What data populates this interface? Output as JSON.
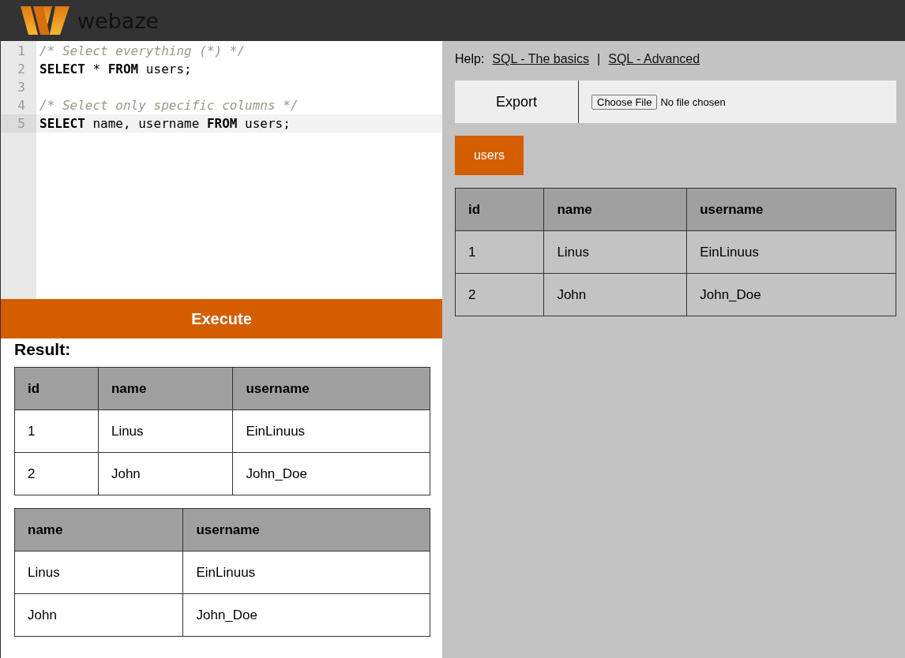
{
  "header": {
    "brand": "webaze"
  },
  "editor": {
    "lines": [
      {
        "number": "1",
        "selected": false,
        "tokens": [
          {
            "kind": "comment",
            "text": "/* Select everything (*) */"
          }
        ]
      },
      {
        "number": "2",
        "selected": false,
        "tokens": [
          {
            "kind": "keyword",
            "text": "SELECT"
          },
          {
            "kind": "plain",
            "text": " * "
          },
          {
            "kind": "keyword",
            "text": "FROM"
          },
          {
            "kind": "plain",
            "text": " users;"
          }
        ]
      },
      {
        "number": "3",
        "selected": false
      },
      {
        "number": "4",
        "selected": false,
        "tokens": [
          {
            "kind": "comment",
            "text": "/* Select only specific columns */"
          }
        ]
      },
      {
        "number": "5",
        "selected": true,
        "tokens": [
          {
            "kind": "keyword",
            "text": "SELECT"
          },
          {
            "kind": "plain",
            "text": " name, username "
          },
          {
            "kind": "keyword",
            "text": "FROM"
          },
          {
            "kind": "plain",
            "text": " users;"
          }
        ]
      }
    ]
  },
  "execute_button": "Execute",
  "result": {
    "heading": "Result:",
    "tables": [
      {
        "columns": [
          "id",
          "name",
          "username"
        ],
        "rows": [
          [
            "1",
            "Linus",
            "EinLinuus"
          ],
          [
            "2",
            "John",
            "John_Doe"
          ]
        ]
      },
      {
        "columns": [
          "name",
          "username"
        ],
        "rows": [
          [
            "Linus",
            "EinLinuus"
          ],
          [
            "John",
            "John_Doe"
          ]
        ]
      }
    ]
  },
  "help": {
    "label": "Help:",
    "links": [
      "SQL - The basics",
      "SQL - Advanced"
    ],
    "separator": "|"
  },
  "export": {
    "button": "Export",
    "file_button": "Choose File",
    "file_status": "No file chosen"
  },
  "table_tabs": [
    {
      "label": "users",
      "selected": true
    }
  ],
  "table_view": {
    "columns": [
      "id",
      "name",
      "username"
    ],
    "rows": [
      [
        "1",
        "Linus",
        "EinLinuus"
      ],
      [
        "2",
        "John",
        "John_Doe"
      ]
    ]
  }
}
